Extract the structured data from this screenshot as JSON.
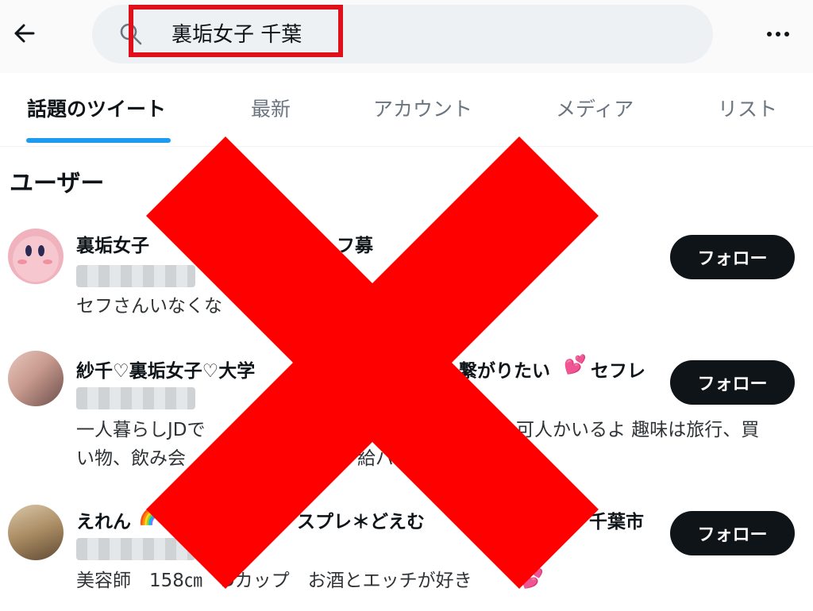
{
  "search": {
    "query": "裏垢女子 千葉"
  },
  "tabs": [
    {
      "label": "話題のツイート"
    },
    {
      "label": "最新"
    },
    {
      "label": "アカウント"
    },
    {
      "label": "メディア"
    },
    {
      "label": "リスト"
    }
  ],
  "section": {
    "title": "ユーザー"
  },
  "users": [
    {
      "name_start": "裏垢女子",
      "name_end": "フ募",
      "bio": [
        "セフさんいなくな"
      ],
      "follow_label": "フォロー"
    },
    {
      "name_start": "紗千♡裏垢女子♡大学",
      "name_end": "繋がりたい",
      "name_suffix": "セフレ",
      "bio": [
        "一人暮らしJDで",
        "可人かいるよ 趣味は旅行、買",
        "い物、飲み会",
        "給バ"
      ],
      "follow_label": "フォロー"
    },
    {
      "name_start": "えれん",
      "name_mid": "スプレ＊どえむ",
      "name_end": "千葉市",
      "bio": [
        "美容師　158㎝　Dカップ　お酒とエッチが好き"
      ],
      "follow_label": "フォロー"
    }
  ],
  "colors": {
    "accent": "#1d9bf0",
    "overlay_x": "#ff0000",
    "highlight_box": "#e0101a"
  }
}
